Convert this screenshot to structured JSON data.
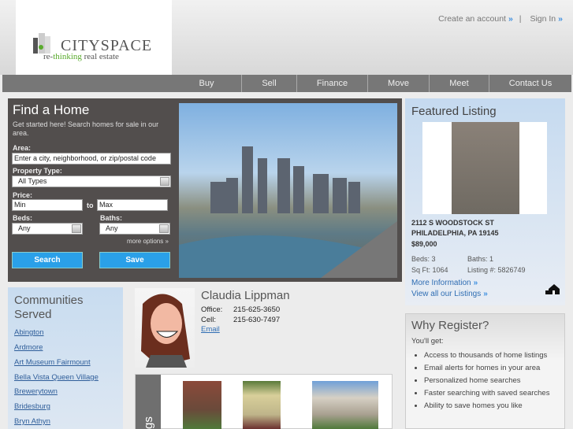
{
  "header": {
    "brand": "CITYSPACE",
    "tagline_pre": "re-",
    "tagline_accent": "thinking",
    "tagline_post": " real estate",
    "create_account": "Create an account",
    "sign_in": "Sign In",
    "separator": "|",
    "chevron": "»"
  },
  "nav": [
    "Buy",
    "Sell",
    "Finance",
    "Move",
    "Meet",
    "Contact Us"
  ],
  "find": {
    "title": "Find a Home",
    "subtitle": "Get started here! Search homes for sale in our area.",
    "area_label": "Area:",
    "area_value": "Enter a city, neighborhood, or zip/postal code",
    "type_label": "Property Type:",
    "type_value": "All Types",
    "price_label": "Price:",
    "min": "Min",
    "to": "to",
    "max": "Max",
    "beds_label": "Beds:",
    "beds_value": "Any",
    "baths_label": "Baths:",
    "baths_value": "Any",
    "more_options": "more options »",
    "search": "Search",
    "save": "Save"
  },
  "featured": {
    "title": "Featured Listing",
    "address1": "2112 S WOODSTOCK ST",
    "address2": "PHILADELPHIA, PA 19145",
    "price": "$89,000",
    "beds": "Beds: 3",
    "baths": "Baths: 1",
    "sqft": "Sq Ft: 1064",
    "listing": "Listing #: 5826749",
    "more_info": "More Information",
    "view_all": "View all our Listings",
    "chevron": "»"
  },
  "communities": {
    "title": "Communities Served",
    "items": [
      "Abington",
      "Ardmore",
      "Art Museum Fairmount",
      "Bella Vista Queen Village",
      "Brewerytown",
      "Bridesburg",
      "Bryn Athyn"
    ]
  },
  "agent": {
    "name": "Claudia Lippman",
    "office_label": "Office:",
    "office": "215-625-3650",
    "cell_label": "Cell:",
    "cell": "215-630-7497",
    "email": "Email"
  },
  "listings_strip": {
    "label": "gs"
  },
  "why": {
    "title": "Why Register?",
    "subtitle": "You'll get:",
    "items": [
      "Access to thousands of home listings",
      "Email alerts for homes in your area",
      "Personalized home searches",
      "Faster searching with saved searches",
      "Ability to save homes you like"
    ]
  },
  "colors": {
    "accent": "#2aa0e8",
    "nav": "#777777",
    "panel": "#524e4d",
    "link": "#2f6db3"
  }
}
